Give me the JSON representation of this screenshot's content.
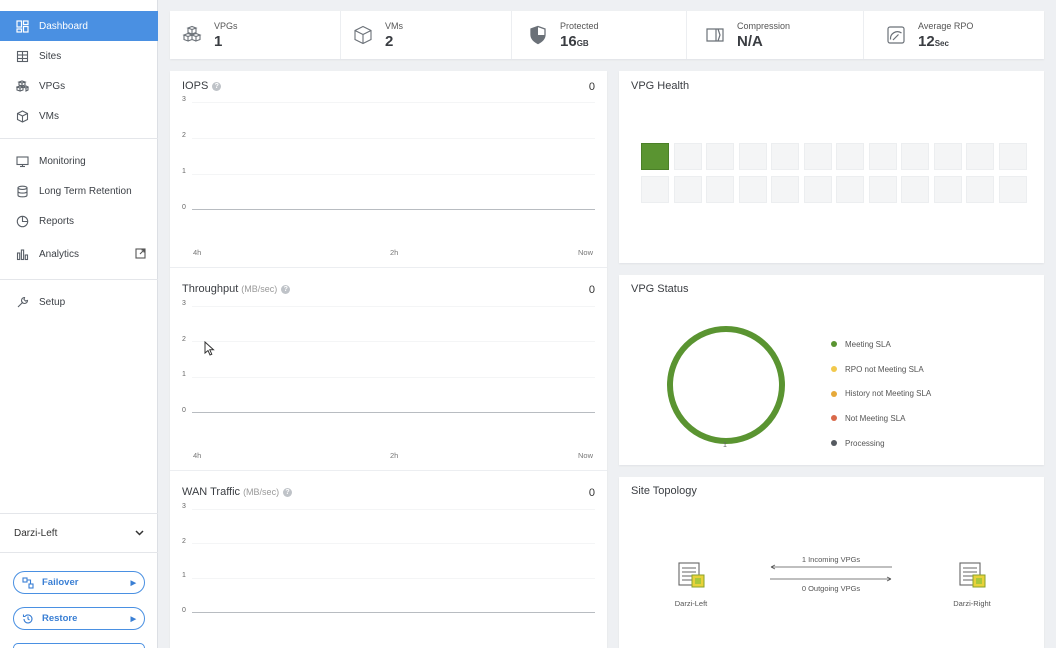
{
  "sidebar": {
    "items": [
      {
        "label": "Dashboard",
        "icon": "dashboard-icon",
        "active": true
      },
      {
        "label": "Sites",
        "icon": "sites-icon"
      },
      {
        "label": "VPGs",
        "icon": "vpgs-icon"
      },
      {
        "label": "VMs",
        "icon": "vms-icon"
      },
      {
        "label": "Monitoring",
        "icon": "monitor-icon"
      },
      {
        "label": "Long Term Retention",
        "icon": "database-icon"
      },
      {
        "label": "Reports",
        "icon": "pie-chart-icon"
      },
      {
        "label": "Analytics",
        "icon": "bar-chart-icon"
      },
      {
        "label": "Setup",
        "icon": "wrench-icon"
      }
    ],
    "site": "Darzi-Left",
    "actions": [
      {
        "label": "Failover",
        "icon": "failover-icon"
      },
      {
        "label": "Restore",
        "icon": "restore-icon"
      }
    ]
  },
  "stats": [
    {
      "label": "VPGs",
      "value": "1",
      "unit": "",
      "icon": "vpg-stack-icon"
    },
    {
      "label": "VMs",
      "value": "2",
      "unit": "",
      "icon": "cube-icon"
    },
    {
      "label": "Protected",
      "value": "16",
      "unit": "GB",
      "icon": "shield-icon"
    },
    {
      "label": "Compression",
      "value": "N/A",
      "unit": "",
      "icon": "compression-icon"
    },
    {
      "label": "Average RPO",
      "value": "12",
      "unit": "Sec",
      "icon": "gauge-icon"
    }
  ],
  "iops": {
    "title": "IOPS",
    "unit": "",
    "value": "0"
  },
  "throughput": {
    "title": "Throughput",
    "unit": "(MB/sec)",
    "value": "0"
  },
  "wan": {
    "title": "WAN Traffic",
    "unit": "(MB/sec)",
    "value": "0"
  },
  "axes": {
    "y_ticks": [
      "3",
      "2",
      "1",
      "0"
    ],
    "x_ticks": [
      "4h",
      "2h",
      "Now"
    ]
  },
  "chart_data": [
    {
      "type": "line",
      "title": "IOPS",
      "x": [
        "4h",
        "2h",
        "Now"
      ],
      "yticks": [
        0,
        1,
        2,
        3
      ],
      "ylim": [
        0,
        3
      ],
      "series": [],
      "current": 0
    },
    {
      "type": "line",
      "title": "Throughput",
      "ylabel": "(MB/sec)",
      "x": [
        "4h",
        "2h",
        "Now"
      ],
      "yticks": [
        0,
        1,
        2,
        3
      ],
      "ylim": [
        0,
        3
      ],
      "series": [],
      "current": 0
    },
    {
      "type": "line",
      "title": "WAN Traffic",
      "ylabel": "(MB/sec)",
      "yticks": [
        0,
        1,
        2,
        3
      ],
      "ylim": [
        0,
        3
      ],
      "series": [],
      "current": 0
    },
    {
      "type": "pie",
      "title": "VPG Status",
      "categories": [
        "Meeting SLA",
        "RPO not Meeting SLA",
        "History not Meeting SLA",
        "Not Meeting SLA",
        "Processing"
      ],
      "values": [
        1,
        0,
        0,
        0,
        0
      ],
      "total": "1"
    }
  ],
  "health": {
    "title": "VPG Health",
    "cells_total": 24,
    "healthy_count": 1
  },
  "status": {
    "title": "VPG Status",
    "total": "1",
    "legend": [
      {
        "label": "Meeting SLA",
        "color": "#5a9431"
      },
      {
        "label": "RPO not Meeting SLA",
        "color": "#f2c94c"
      },
      {
        "label": "History not Meeting SLA",
        "color": "#e6a93a"
      },
      {
        "label": "Not Meeting SLA",
        "color": "#d9694a"
      },
      {
        "label": "Processing",
        "color": "#555a60"
      }
    ],
    "ring_color": "#5a9431"
  },
  "topology": {
    "title": "Site Topology",
    "left_site": "Darzi-Left",
    "right_site": "Darzi-Right",
    "incoming": "1 Incoming VPGs",
    "outgoing": "0 Outgoing VPGs"
  }
}
